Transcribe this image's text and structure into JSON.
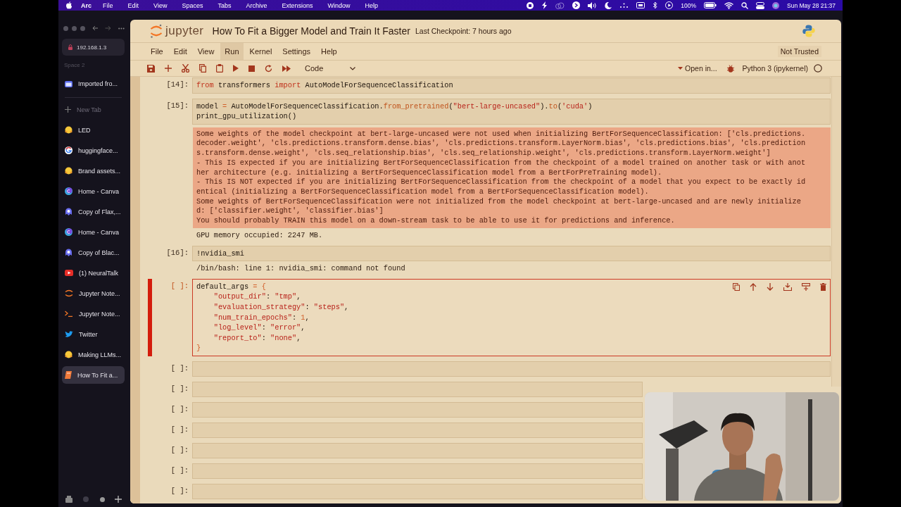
{
  "menu_bar": {
    "app": "Arc",
    "menus": [
      "File",
      "Edit",
      "View",
      "Spaces",
      "Tabs",
      "Archive",
      "Extensions",
      "Window",
      "Help"
    ],
    "battery": "100%",
    "clock": "Sun May 28  21:37"
  },
  "browser": {
    "address": "192.168.1.3",
    "space": "Space 2",
    "pinned": [
      {
        "title": "Imported fro...",
        "kind": "folder"
      }
    ],
    "new_tab": "New Tab",
    "tabs": [
      {
        "title": "LED",
        "kind": "hug",
        "selected": false
      },
      {
        "title": "huggingface...",
        "kind": "google",
        "selected": false
      },
      {
        "title": "Brand assets...",
        "kind": "hug",
        "selected": false
      },
      {
        "title": "Home - Canva",
        "kind": "canva",
        "selected": false
      },
      {
        "title": "Copy of Flax,...",
        "kind": "blob",
        "selected": false
      },
      {
        "title": "Home - Canva",
        "kind": "canva",
        "selected": false
      },
      {
        "title": "Copy of Blac...",
        "kind": "blob",
        "selected": false
      },
      {
        "title": "(1) NeuralTalk",
        "kind": "video",
        "selected": false
      },
      {
        "title": "Jupyter Note...",
        "kind": "orbit",
        "selected": false
      },
      {
        "title": "Jupyter Note...",
        "kind": "terminal",
        "selected": false
      },
      {
        "title": "Twitter",
        "kind": "bird",
        "selected": false
      },
      {
        "title": "Making LLMs...",
        "kind": "hug",
        "selected": false
      },
      {
        "title": "How To Fit a...",
        "kind": "book",
        "selected": true
      }
    ]
  },
  "notebook": {
    "logo_text": "jupyter",
    "title": "How To Fit a Bigger Model and Train It Faster",
    "checkpoint": "Last Checkpoint: 7 hours ago",
    "menus": [
      {
        "label": "File",
        "selected": false
      },
      {
        "label": "Edit",
        "selected": false
      },
      {
        "label": "View",
        "selected": false
      },
      {
        "label": "Run",
        "selected": true
      },
      {
        "label": "Kernel",
        "selected": false
      },
      {
        "label": "Settings",
        "selected": false
      },
      {
        "label": "Help",
        "selected": false
      }
    ],
    "trust": "Not Trusted",
    "cell_type": "Code",
    "open_in": "Open in...",
    "kernel": "Python 3 (ipykernel)",
    "cells": [
      {
        "prompt": "[14]:",
        "selected": false,
        "lines": [
          [
            {
              "kind": "kw",
              "text": "from"
            },
            {
              "kind": "plain",
              "text": " transformers "
            },
            {
              "kind": "kw",
              "text": "import"
            },
            {
              "kind": "plain",
              "text": " AutoModelForSequenceClassification"
            }
          ]
        ]
      },
      {
        "prompt": "[15]:",
        "selected": false,
        "lines": [
          [
            {
              "kind": "plain",
              "text": "model "
            },
            {
              "kind": "op",
              "text": "="
            },
            {
              "kind": "plain",
              "text": " AutoModelForSequenceClassification."
            },
            {
              "kind": "fn",
              "text": "from_pretrained"
            },
            {
              "kind": "plain",
              "text": "("
            },
            {
              "kind": "str",
              "text": "\"bert-large-uncased\""
            },
            {
              "kind": "plain",
              "text": ")."
            },
            {
              "kind": "fn",
              "text": "to"
            },
            {
              "kind": "plain",
              "text": "("
            },
            {
              "kind": "str",
              "text": "'cuda'"
            },
            {
              "kind": "plain",
              "text": ")"
            }
          ],
          [
            {
              "kind": "plain",
              "text": "print_gpu_utilization()"
            }
          ]
        ],
        "outputs": [
          {
            "kind": "stderr",
            "lines": [
              "Some weights of the model checkpoint at bert-large-uncased were not used when initializing BertForSequenceClassification: ['cls.predictions.",
              "decoder.weight', 'cls.predictions.transform.dense.bias', 'cls.predictions.transform.LayerNorm.bias', 'cls.predictions.bias', 'cls.prediction",
              "s.transform.dense.weight', 'cls.seq_relationship.bias', 'cls.seq_relationship.weight', 'cls.predictions.transform.LayerNorm.weight']",
              "- This IS expected if you are initializing BertForSequenceClassification from the checkpoint of a model trained on another task or with anot",
              "her architecture (e.g. initializing a BertForSequenceClassification model from a BertForPreTraining model).",
              "- This IS NOT expected if you are initializing BertForSequenceClassification from the checkpoint of a model that you expect to be exactly id",
              "entical (initializing a BertForSequenceClassification model from a BertForSequenceClassification model).",
              "Some weights of BertForSequenceClassification were not initialized from the model checkpoint at bert-large-uncased and are newly initialize",
              "d: ['classifier.weight', 'classifier.bias']",
              "You should probably TRAIN this model on a down-stream task to be able to use it for predictions and inference."
            ]
          },
          {
            "kind": "stdout",
            "lines": [
              "GPU memory occupied: 2247 MB."
            ]
          }
        ]
      },
      {
        "prompt": "[16]:",
        "selected": false,
        "lines": [
          [
            {
              "kind": "plain",
              "text": "!nvidia_smi"
            }
          ]
        ],
        "outputs": [
          {
            "kind": "stdout",
            "lines": [
              "/bin/bash: line 1: nvidia_smi: command not found"
            ]
          }
        ]
      },
      {
        "prompt": "[ ]:",
        "selected": true,
        "lines": [
          [
            {
              "kind": "plain",
              "text": "default_args "
            },
            {
              "kind": "op",
              "text": "= {"
            }
          ],
          [
            {
              "kind": "str",
              "text": "    \"output_dir\""
            },
            {
              "kind": "plain",
              "text": ": "
            },
            {
              "kind": "str",
              "text": "\"tmp\""
            },
            {
              "kind": "plain",
              "text": ","
            }
          ],
          [
            {
              "kind": "str",
              "text": "    \"evaluation_strategy\""
            },
            {
              "kind": "plain",
              "text": ": "
            },
            {
              "kind": "str",
              "text": "\"steps\""
            },
            {
              "kind": "plain",
              "text": ","
            }
          ],
          [
            {
              "kind": "str",
              "text": "    \"num_train_epochs\""
            },
            {
              "kind": "plain",
              "text": ": "
            },
            {
              "kind": "num",
              "text": "1"
            },
            {
              "kind": "plain",
              "text": ","
            }
          ],
          [
            {
              "kind": "str",
              "text": "    \"log_level\""
            },
            {
              "kind": "plain",
              "text": ": "
            },
            {
              "kind": "str",
              "text": "\"error\""
            },
            {
              "kind": "plain",
              "text": ","
            }
          ],
          [
            {
              "kind": "str",
              "text": "    \"report_to\""
            },
            {
              "kind": "plain",
              "text": ": "
            },
            {
              "kind": "str",
              "text": "\"none\""
            },
            {
              "kind": "plain",
              "text": ","
            }
          ],
          [
            {
              "kind": "op",
              "text": "}"
            }
          ]
        ]
      },
      {
        "prompt": "[ ]:",
        "selected": false
      },
      {
        "prompt": "[ ]:",
        "selected": false
      },
      {
        "prompt": "[ ]:",
        "selected": false
      },
      {
        "prompt": "[ ]:",
        "selected": false
      },
      {
        "prompt": "[ ]:",
        "selected": false
      },
      {
        "prompt": "[ ]:",
        "selected": false
      },
      {
        "prompt": "[ ]:",
        "selected": false
      }
    ]
  }
}
